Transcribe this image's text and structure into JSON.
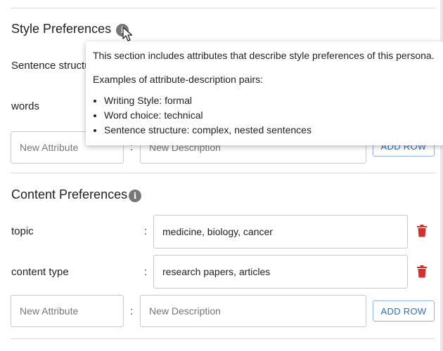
{
  "style_section": {
    "title": "Style Preferences",
    "rows": [
      {
        "attribute": "Sentence structure"
      },
      {
        "attribute": "words"
      }
    ],
    "new_row": {
      "attribute_placeholder": "New Attribute",
      "description_placeholder": "New Description",
      "add_label": "ADD ROW"
    }
  },
  "tooltip": {
    "description": "This section includes attributes that describe style preferences of this persona.",
    "examples_heading": "Examples of attribute-description pairs:",
    "examples": [
      "Writing Style: formal",
      "Word choice: technical",
      "Sentence structure: complex, nested sentences"
    ]
  },
  "content_section": {
    "title": "Content Preferences",
    "rows": [
      {
        "attribute": "topic",
        "description": "medicine, biology, cancer"
      },
      {
        "attribute": "content type",
        "description": "research papers, articles"
      }
    ],
    "new_row": {
      "attribute_placeholder": "New Attribute",
      "description_placeholder": "New Description",
      "add_label": "ADD ROW"
    }
  },
  "separator": ":",
  "colors": {
    "accent": "#2a6fc4",
    "delete": "#d32f2f",
    "info_icon": "#777777"
  }
}
